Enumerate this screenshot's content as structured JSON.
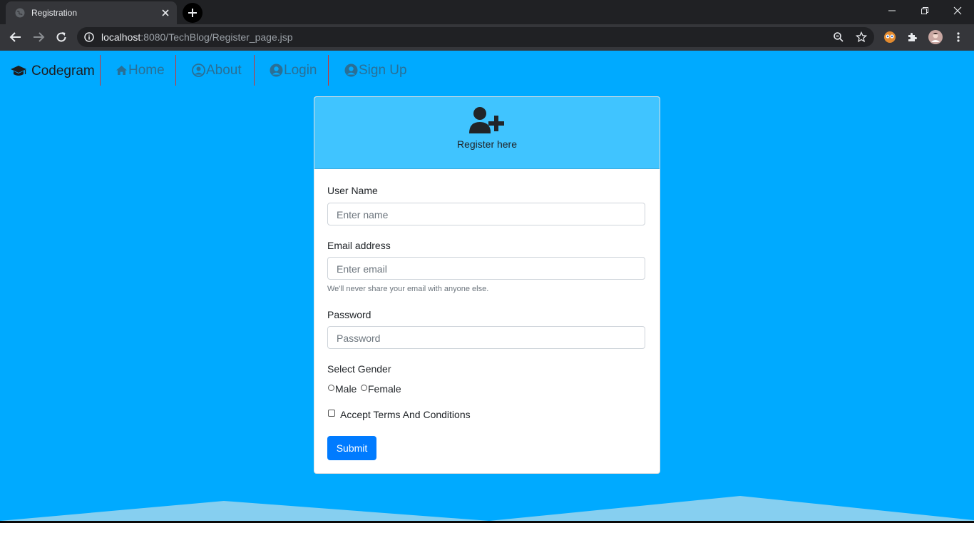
{
  "browser": {
    "tab_title": "Registration",
    "url_host": "localhost",
    "url_rest": ":8080/TechBlog/Register_page.jsp"
  },
  "navbar": {
    "brand": "Codegram",
    "items": [
      {
        "label": "Home"
      },
      {
        "label": "About"
      },
      {
        "label": "Login"
      },
      {
        "label": "Sign Up"
      }
    ]
  },
  "form": {
    "header_text": "Register here",
    "username_label": "User Name",
    "username_placeholder": "Enter name",
    "email_label": "Email address",
    "email_placeholder": "Enter email",
    "email_help": "We'll never share your email with anyone else.",
    "password_label": "Password",
    "password_placeholder": "Password",
    "gender_label": "Select Gender",
    "gender_options": [
      "Male",
      "Female"
    ],
    "terms_label": "Accept Terms And Conditions",
    "submit_label": "Submit"
  },
  "colors": {
    "page_bg": "#00aaff",
    "card_header_bg": "#40c4ff",
    "submit_bg": "#007bff",
    "divider": "#d0322e"
  }
}
